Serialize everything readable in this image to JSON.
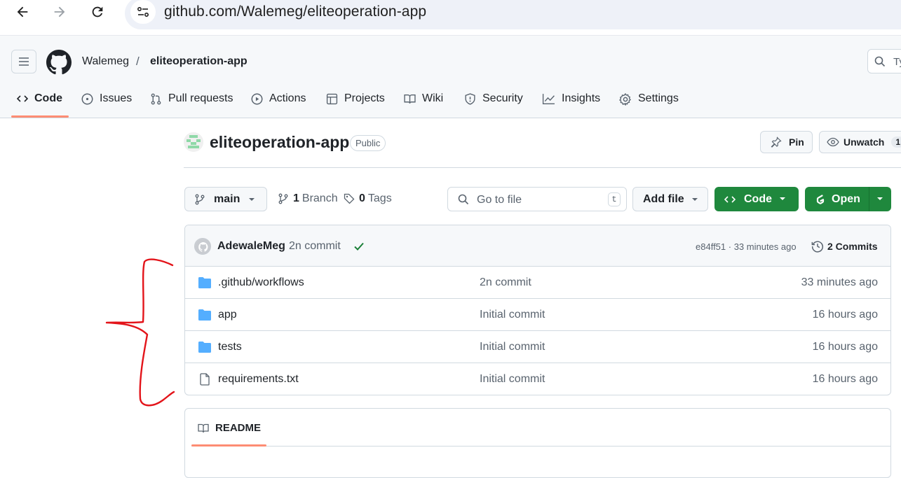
{
  "browser": {
    "url": "github.com/Walemeg/eliteoperation-app",
    "icons": [
      "back-arrow-icon",
      "forward-arrow-icon",
      "reload-icon",
      "site-info-icon"
    ]
  },
  "header": {
    "owner": "Walemeg",
    "separator": "/",
    "repo": "eliteoperation-app",
    "search_placeholder": "Ty"
  },
  "tabs": [
    {
      "label": "Code",
      "icon": "code-icon",
      "active": true
    },
    {
      "label": "Issues",
      "icon": "issue-icon"
    },
    {
      "label": "Pull requests",
      "icon": "pull-request-icon"
    },
    {
      "label": "Actions",
      "icon": "play-icon"
    },
    {
      "label": "Projects",
      "icon": "table-icon"
    },
    {
      "label": "Wiki",
      "icon": "book-icon"
    },
    {
      "label": "Security",
      "icon": "shield-icon"
    },
    {
      "label": "Insights",
      "icon": "graph-icon"
    },
    {
      "label": "Settings",
      "icon": "gear-icon"
    }
  ],
  "repo": {
    "name": "eliteoperation-app",
    "visibility": "Public",
    "pin_label": "Pin",
    "unwatch_label": "Unwatch",
    "watch_count": "1"
  },
  "toolbar": {
    "branch": "main",
    "branch_count": "1",
    "branch_label": "Branch",
    "tag_count": "0",
    "tag_label": "Tags",
    "goto_placeholder": "Go to file",
    "goto_shortcut": "t",
    "add_file_label": "Add file",
    "code_label": "Code",
    "open_label": "Open"
  },
  "latest_commit": {
    "author": "AdewaleMeg",
    "message": "2n commit",
    "status": "success",
    "hash_time": "e84ff51 · 33 minutes ago",
    "commits_label": "2 Commits"
  },
  "files": [
    {
      "name": ".github/workflows",
      "type": "folder",
      "commit": "2n commit",
      "time": "33 minutes ago"
    },
    {
      "name": "app",
      "type": "folder",
      "commit": "Initial commit",
      "time": "16 hours ago"
    },
    {
      "name": "tests",
      "type": "folder",
      "commit": "Initial commit",
      "time": "16 hours ago"
    },
    {
      "name": "requirements.txt",
      "type": "file",
      "commit": "Initial commit",
      "time": "16 hours ago"
    }
  ],
  "readme": {
    "tab_label": "README"
  },
  "colors": {
    "primary_green": "#1f883d",
    "tab_underline": "#fd8c73",
    "folder_blue": "#54aeff",
    "annotation_red": "#e3141a"
  }
}
